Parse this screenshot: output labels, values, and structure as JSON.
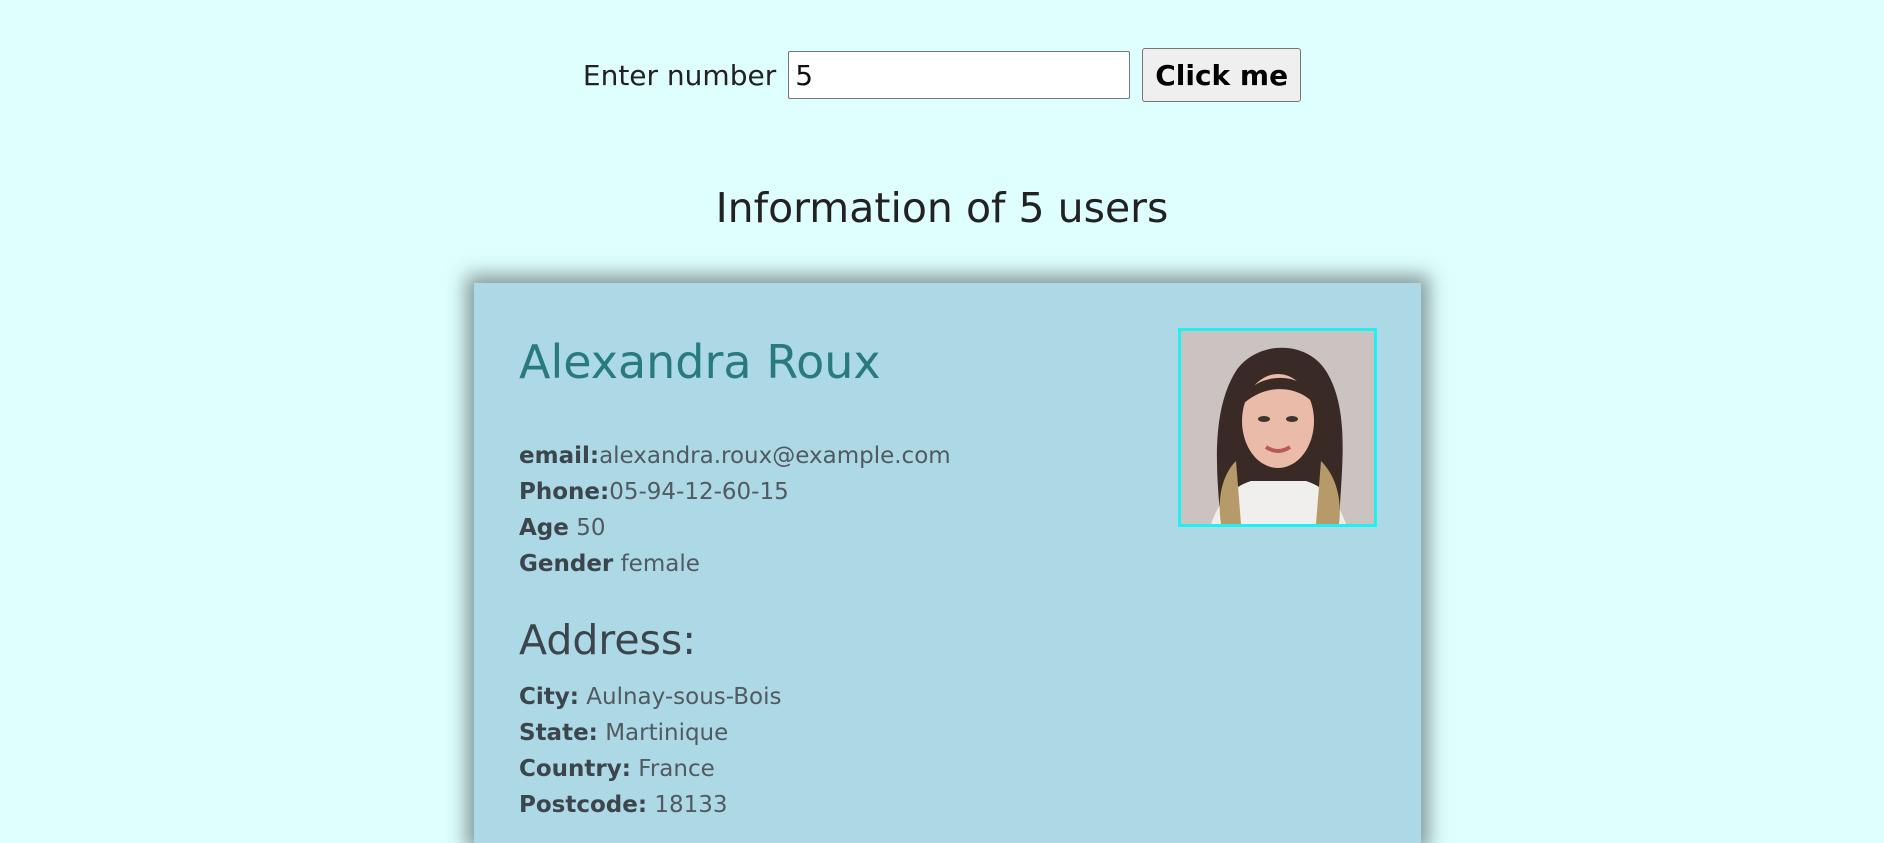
{
  "form": {
    "label": "Enter number",
    "input_value": "5",
    "button_label": "Click me"
  },
  "heading": "Information of 5 users",
  "user": {
    "name": "Alexandra Roux",
    "email_label": "email:",
    "email": "alexandra.roux@example.com",
    "phone_label": "Phone:",
    "phone": "05-94-12-60-15",
    "age_label": "Age",
    "age": "50",
    "gender_label": "Gender",
    "gender": "female",
    "address_title": "Address:",
    "city_label": "City:",
    "city": "Aulnay-sous-Bois",
    "state_label": "State:",
    "state": "Martinique",
    "country_label": "Country:",
    "country": "France",
    "postcode_label": "Postcode:",
    "postcode": "18133"
  },
  "colors": {
    "page_background": "#dfffff",
    "card_background": "#add8e6",
    "name_color": "#287a7f",
    "photo_border": "#20f0f0"
  }
}
